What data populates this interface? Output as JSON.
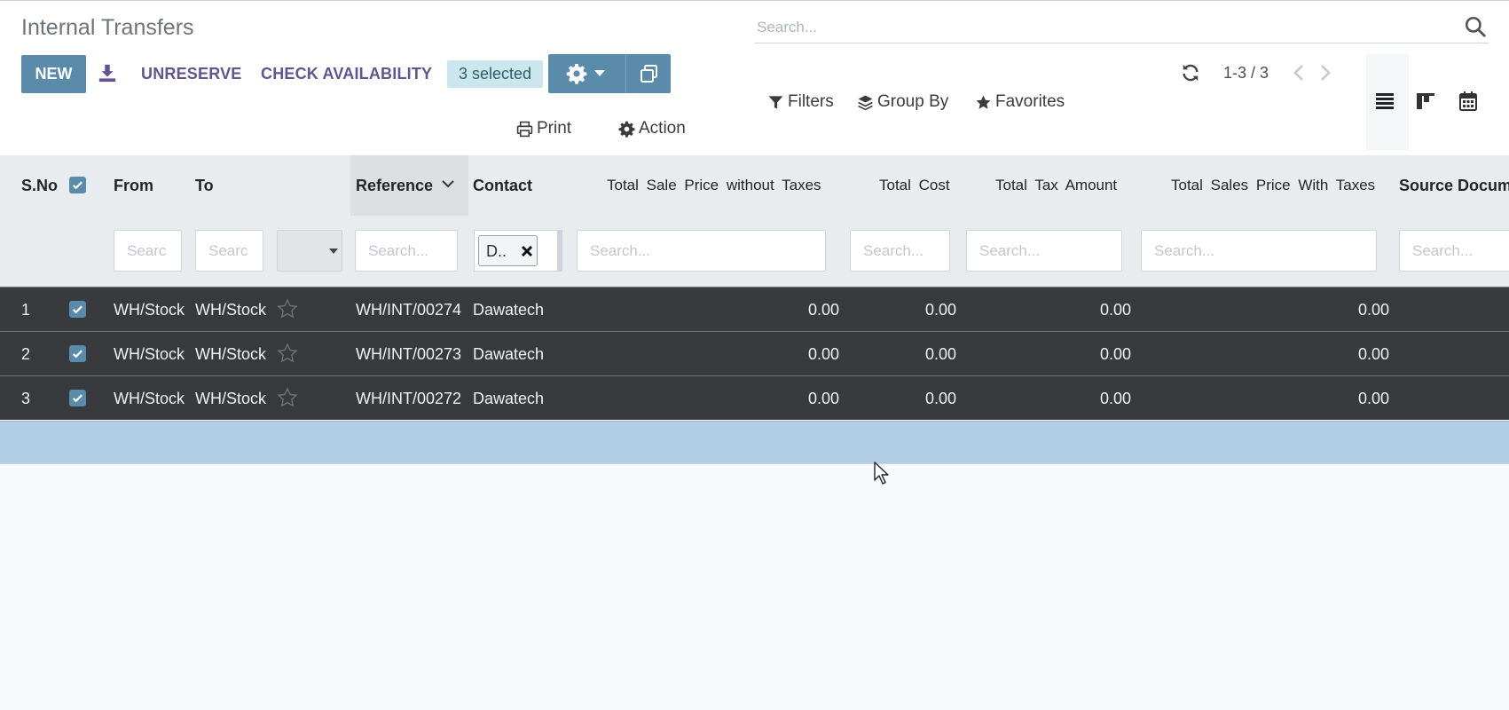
{
  "page": {
    "title": "Internal Transfers"
  },
  "search": {
    "placeholder": "Search..."
  },
  "toolbar": {
    "new_label": "NEW",
    "unreserve_label": "UNRESERVE",
    "check_availability_label": "CHECK AVAILABILITY",
    "selected_label": "3 selected",
    "print_label": "Print",
    "action_label": "Action"
  },
  "filters": {
    "filters_label": "Filters",
    "groupby_label": "Group By",
    "favorites_label": "Favorites"
  },
  "pager": {
    "text": "1-3 / 3"
  },
  "table": {
    "headers": {
      "sno": "S.No",
      "from": "From",
      "to": "To",
      "reference": "Reference",
      "contact": "Contact",
      "sale_no_tax": "Total Sale Price without Taxes",
      "cost": "Total Cost",
      "tax": "Total Tax Amount",
      "sale_with_tax": "Total Sales Price With Taxes",
      "source": "Source Docum"
    },
    "filter_placeholders": {
      "short": "Searc",
      "full": "Search..."
    },
    "contact_filter_tag": "D..",
    "rows": [
      {
        "sno": "1",
        "from": "WH/Stock",
        "to": "WH/Stock",
        "reference": "WH/INT/00274",
        "contact": "Dawatech",
        "sale_no_tax": "0.00",
        "cost": "0.00",
        "tax": "0.00",
        "sale_with_tax": "0.00"
      },
      {
        "sno": "2",
        "from": "WH/Stock",
        "to": "WH/Stock",
        "reference": "WH/INT/00273",
        "contact": "Dawatech",
        "sale_no_tax": "0.00",
        "cost": "0.00",
        "tax": "0.00",
        "sale_with_tax": "0.00"
      },
      {
        "sno": "3",
        "from": "WH/Stock",
        "to": "WH/Stock",
        "reference": "WH/INT/00272",
        "contact": "Dawatech",
        "sale_no_tax": "0.00",
        "cost": "0.00",
        "tax": "0.00",
        "sale_with_tax": "0.00"
      }
    ]
  },
  "colors": {
    "primary": "#5a8bab",
    "link": "#62548e",
    "selected_badge": "#cbe6ed",
    "row_selected": "#383a3d",
    "empty_row": "#b1cde4"
  },
  "icons": [
    "search-icon",
    "download-icon",
    "gear-icon",
    "caret-down-icon",
    "copy-icon",
    "print-icon",
    "action-gear-icon",
    "filter-icon",
    "layers-icon",
    "star-icon",
    "refresh-icon",
    "chevron-left-icon",
    "chevron-right-icon",
    "list-view-icon",
    "kanban-view-icon",
    "calendar-view-icon",
    "checkbox-icon",
    "close-icon",
    "cursor-icon"
  ]
}
